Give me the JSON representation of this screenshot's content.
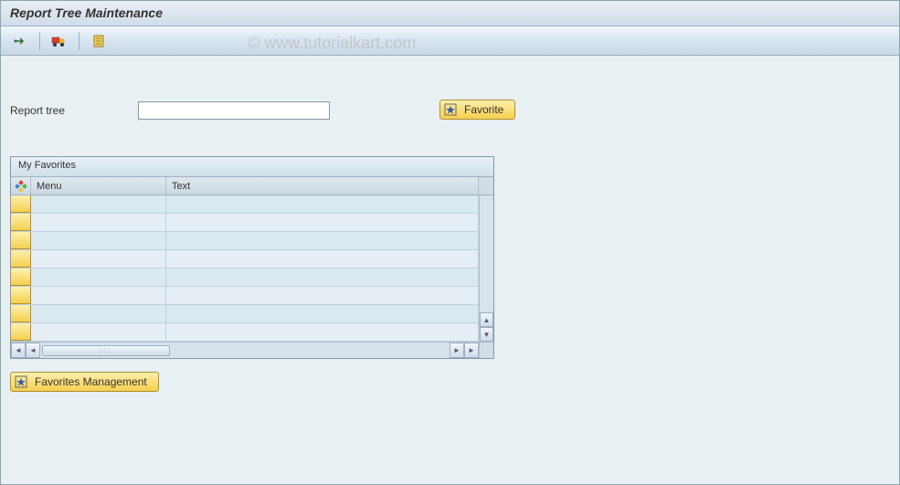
{
  "window": {
    "title": "Report Tree Maintenance"
  },
  "toolbar": {
    "icons": [
      "arrow",
      "transport",
      "display"
    ]
  },
  "form": {
    "report_tree_label": "Report tree",
    "report_tree_value": ""
  },
  "buttons": {
    "favorite": "Favorite",
    "favorites_management": "Favorites Management"
  },
  "favorites_panel": {
    "title": "My Favorites",
    "columns": {
      "menu": "Menu",
      "text": "Text"
    },
    "rows": [
      {
        "menu": "",
        "text": ""
      },
      {
        "menu": "",
        "text": ""
      },
      {
        "menu": "",
        "text": ""
      },
      {
        "menu": "",
        "text": ""
      },
      {
        "menu": "",
        "text": ""
      },
      {
        "menu": "",
        "text": ""
      },
      {
        "menu": "",
        "text": ""
      },
      {
        "menu": "",
        "text": ""
      }
    ]
  },
  "watermark": "© www.tutorialkart.com"
}
